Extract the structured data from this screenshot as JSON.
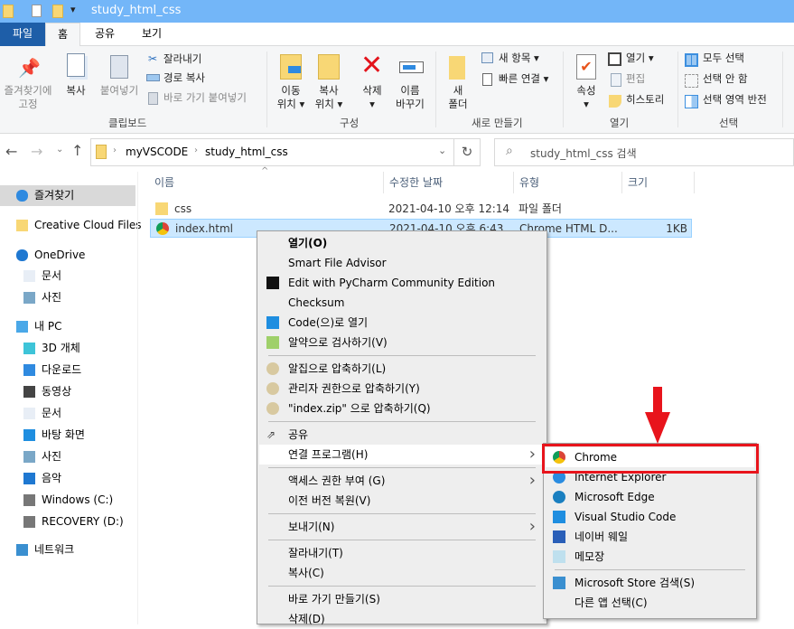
{
  "window": {
    "title": "study_html_css"
  },
  "tabs": [
    {
      "label": "파일"
    },
    {
      "label": "홈"
    },
    {
      "label": "공유"
    },
    {
      "label": "보기"
    }
  ],
  "ribbon": {
    "clipboard": {
      "label": "클립보드",
      "pin": "즐겨찾기에\n고정",
      "copy": "복사",
      "paste": "붙여넣기",
      "cut": "잘라내기",
      "copy_path": "경로 복사",
      "paste_shortcut": "바로 가기 붙여넣기"
    },
    "organize": {
      "label": "구성",
      "move_to": "이동\n위치 ▾",
      "copy_to": "복사\n위치 ▾",
      "delete": "삭제\n▾",
      "rename": "이름\n바꾸기"
    },
    "new": {
      "label": "새로 만들기",
      "new_folder": "새\n폴더",
      "new_item": "새 항목 ▾",
      "easy_access": "빠른 연결 ▾"
    },
    "open": {
      "label": "열기",
      "properties": "속성\n▾",
      "open": "열기 ▾",
      "edit": "편집",
      "history": "히스토리"
    },
    "select": {
      "label": "선택",
      "select_all": "모두 선택",
      "select_none": "선택 안 함",
      "invert": "선택 영역 반전"
    }
  },
  "address": {
    "path": [
      "myVSCODE",
      "study_html_css"
    ],
    "search_placeholder": "study_html_css 검색"
  },
  "sidebar": {
    "items": [
      {
        "label": "즐겨찾기",
        "icon": "star-icon",
        "selected": true
      },
      {
        "label": "Creative Cloud Files",
        "icon": "creative-cloud-icon"
      },
      {
        "label": "OneDrive",
        "icon": "cloud-icon"
      },
      {
        "label": "문서",
        "icon": "document-icon"
      },
      {
        "label": "사진",
        "icon": "pictures-icon"
      },
      {
        "label": "내 PC",
        "icon": "computer-icon"
      },
      {
        "label": "3D 개체",
        "icon": "3d-objects-icon"
      },
      {
        "label": "다운로드",
        "icon": "download-icon"
      },
      {
        "label": "동영상",
        "icon": "video-icon"
      },
      {
        "label": "문서",
        "icon": "document-icon"
      },
      {
        "label": "바탕 화면",
        "icon": "desktop-icon"
      },
      {
        "label": "사진",
        "icon": "pictures-icon"
      },
      {
        "label": "음악",
        "icon": "music-icon"
      },
      {
        "label": "Windows (C:)",
        "icon": "drive-icon"
      },
      {
        "label": "RECOVERY (D:)",
        "icon": "drive-icon"
      },
      {
        "label": "네트워크",
        "icon": "network-icon"
      }
    ]
  },
  "columns": [
    "이름",
    "수정한 날짜",
    "유형",
    "크기"
  ],
  "files": [
    {
      "name": "css",
      "date": "2021-04-10 오후 12:14",
      "type": "파일 폴더",
      "size": "",
      "icon": "folder-icon"
    },
    {
      "name": "index.html",
      "date": "2021-04-10 오후 6:43",
      "type": "Chrome HTML D...",
      "size": "1KB",
      "icon": "chrome-icon",
      "selected": true
    }
  ],
  "context_menu": {
    "items": [
      {
        "label": "열기(O)",
        "bold": true
      },
      {
        "label": "Smart File Advisor"
      },
      {
        "label": "Edit with PyCharm Community Edition",
        "icon": "pycharm-icon"
      },
      {
        "label": "Checksum"
      },
      {
        "label": "Code(으)로 열기",
        "icon": "vscode-icon"
      },
      {
        "label": "알약으로 검사하기(V)",
        "icon": "alyac-icon"
      },
      {
        "sep": true
      },
      {
        "label": "알집으로 압축하기(L)",
        "icon": "alzip-icon"
      },
      {
        "label": "관리자 권한으로 압축하기(Y)",
        "icon": "alzip-admin-icon"
      },
      {
        "label": "\"index.zip\" 으로 압축하기(Q)",
        "icon": "alzip-icon"
      },
      {
        "sep": true
      },
      {
        "label": "공유",
        "icon": "share-icon"
      },
      {
        "label": "연결 프로그램(H)",
        "submenu": true,
        "highlighted": true
      },
      {
        "sep": true
      },
      {
        "label": "액세스 권한 부여 (G)",
        "submenu": true
      },
      {
        "label": "이전 버전 복원(V)"
      },
      {
        "sep": true
      },
      {
        "label": "보내기(N)",
        "submenu": true
      },
      {
        "sep": true
      },
      {
        "label": "잘라내기(T)"
      },
      {
        "label": "복사(C)"
      },
      {
        "sep": true
      },
      {
        "label": "바로 가기 만들기(S)"
      },
      {
        "label": "삭제(D)"
      }
    ]
  },
  "open_with_menu": {
    "items": [
      {
        "label": "Chrome",
        "icon": "chrome-icon",
        "highlighted": true
      },
      {
        "label": "Internet Explorer",
        "icon": "ie-icon"
      },
      {
        "label": "Microsoft Edge",
        "icon": "edge-icon"
      },
      {
        "label": "Visual Studio Code",
        "icon": "vscode-icon"
      },
      {
        "label": "네이버 웨일",
        "icon": "whale-icon"
      },
      {
        "label": "메모장",
        "icon": "notepad-icon"
      },
      {
        "sep": true
      },
      {
        "label": "Microsoft Store 검색(S)",
        "icon": "store-icon"
      },
      {
        "label": "다른 앱 선택(C)"
      }
    ]
  },
  "annotation": {
    "color": "#e8141c"
  },
  "colors": {
    "titlebar": "#73b6f8",
    "file_tab": "#1e5ea8",
    "selection": "#cce8ff"
  }
}
